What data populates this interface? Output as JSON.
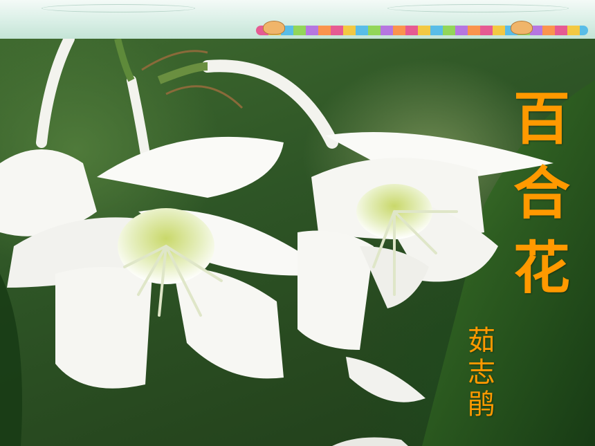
{
  "slide": {
    "title_chars": [
      "百",
      "合",
      "花"
    ],
    "author_chars": [
      "茹",
      "志",
      "鹃"
    ]
  },
  "colors": {
    "title": "#ff9900",
    "author": "#ff9900"
  }
}
